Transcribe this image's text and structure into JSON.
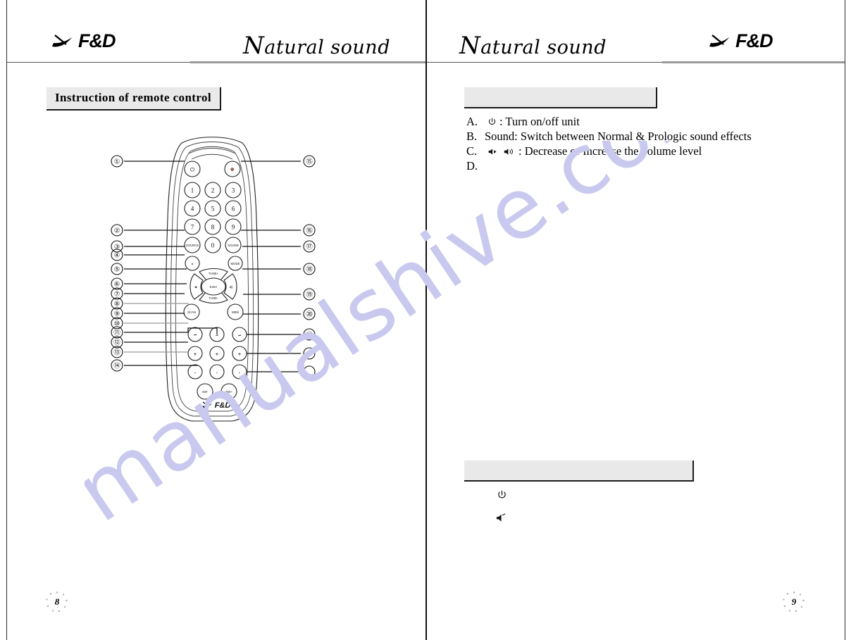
{
  "document": {
    "type": "manual-spread",
    "left_page": {
      "number": "8",
      "header": {
        "brand": "F&D",
        "tagline_cap": "N",
        "tagline_rest": "atural sound"
      },
      "section_title": "Instruction of remote control",
      "diagram": {
        "name": "remote-control-diagram",
        "buttons": [
          {
            "id": "power",
            "label": "⏻"
          },
          {
            "id": "mute",
            "label": "mute"
          },
          {
            "id": "num1",
            "label": "1"
          },
          {
            "id": "num2",
            "label": "2"
          },
          {
            "id": "num3",
            "label": "3"
          },
          {
            "id": "num4",
            "label": "4"
          },
          {
            "id": "num5",
            "label": "5"
          },
          {
            "id": "num6",
            "label": "6"
          },
          {
            "id": "num7",
            "label": "7"
          },
          {
            "id": "num8",
            "label": "8"
          },
          {
            "id": "num9",
            "label": "9"
          },
          {
            "id": "num0",
            "label": "0"
          },
          {
            "id": "source",
            "label": "SOURCE"
          },
          {
            "id": "sound",
            "label": "SOUND"
          },
          {
            "id": "mute2",
            "label": "✶"
          },
          {
            "id": "mode",
            "label": "MODE"
          },
          {
            "id": "tune-up",
            "label": "TUNE+"
          },
          {
            "id": "tune-down",
            "label": "TUNE-"
          },
          {
            "id": "enter",
            "label": "Enter"
          },
          {
            "id": "vol-down",
            "label": "◂▸"
          },
          {
            "id": "vol-up",
            "label": "◂⟖"
          },
          {
            "id": "scan",
            "label": "SCAN"
          },
          {
            "id": "mem",
            "label": "MEM"
          },
          {
            "id": "prev",
            "label": "⏮"
          },
          {
            "id": "play-pause",
            "label": "⏯"
          },
          {
            "id": "next",
            "label": "⏭"
          },
          {
            "id": "plus-left",
            "label": "+"
          },
          {
            "id": "plus-mid",
            "label": "+"
          },
          {
            "id": "plus-right",
            "label": "+"
          },
          {
            "id": "minus-left",
            "label": "-"
          },
          {
            "id": "minus-mid",
            "label": "-"
          },
          {
            "id": "minus-right",
            "label": "-"
          },
          {
            "id": "sw-down",
            "label": "SW-"
          },
          {
            "id": "sw-up",
            "label": "SW+"
          },
          {
            "id": "brand-logo",
            "label": "F&D"
          }
        ],
        "callouts_left": [
          "①",
          "②",
          "③",
          "④",
          "⑤",
          "⑥",
          "⑦",
          "⑧",
          "⑨",
          "⑩",
          "⑪",
          "⑫",
          "⑬",
          "⑭"
        ],
        "callouts_right": [
          "⑮",
          "⑯",
          "⑰",
          "⑱",
          "⑲",
          "⑳",
          "㉑",
          "",
          ""
        ]
      }
    },
    "right_page": {
      "number": "9",
      "header": {
        "brand": "F&D",
        "tagline_cap": "N",
        "tagline_rest": "atural sound"
      },
      "title_box_top": "",
      "title_box_bottom": "",
      "instructions": [
        {
          "key": "A.",
          "icon": "power-icon",
          "text": ": Turn on/off unit"
        },
        {
          "key": "B.",
          "icon": "",
          "text": "Sound: Switch between Normal & Prologic sound effects"
        },
        {
          "key": "C.",
          "icon": "volume-pair-icon",
          "text": ": Decrease or Increase the volume level"
        },
        {
          "key": "D.",
          "icon": "",
          "text": ""
        }
      ],
      "bottom_icons": [
        {
          "name": "power-icon",
          "glyph": "⏻"
        },
        {
          "name": "mute-icon",
          "glyph": "🔇"
        }
      ]
    },
    "watermark": "manualshive.com",
    "colors": {
      "ink": "#000000",
      "gray_box": "#e9e9e9",
      "rule_gray": "#9a9a9a",
      "watermark": "#c9c9ef"
    }
  }
}
